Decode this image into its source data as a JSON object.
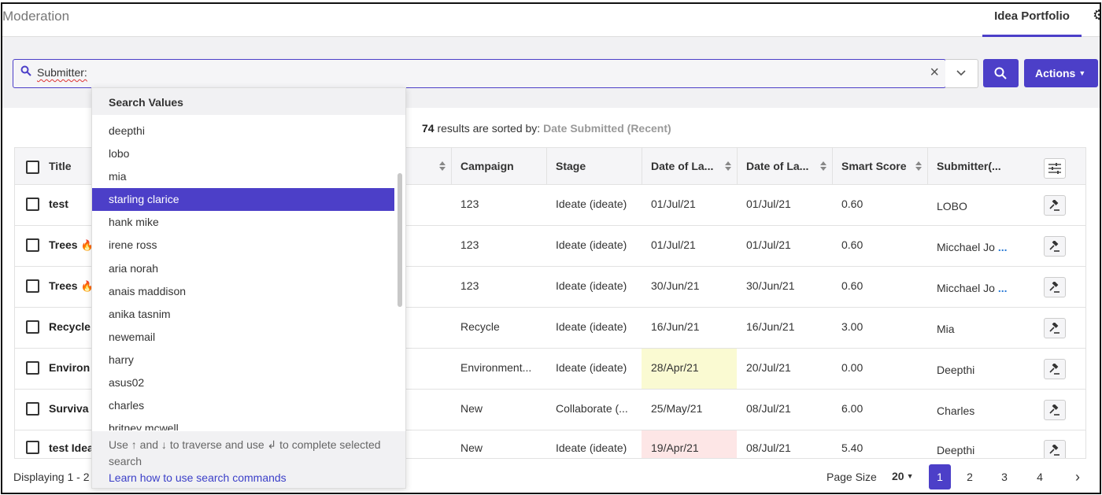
{
  "header": {
    "title": "Moderation",
    "tab": "Idea Portfolio",
    "settings_icon": "gear-icon"
  },
  "search": {
    "value": "Submitter:",
    "clear_icon": "close-icon",
    "toggle_icon": "chevron-down-icon",
    "search_icon": "search-icon",
    "actions_label": "Actions"
  },
  "results": {
    "count": "74",
    "text": "results are sorted by:",
    "sort": "Date Submitted (Recent)"
  },
  "columns": [
    "Title",
    "Campaign",
    "Stage",
    "Date of La...",
    "Date of La...",
    "Smart Score",
    "Submitter(..."
  ],
  "rows": [
    {
      "title": "test",
      "campaign": "123",
      "stage": "Ideate (ideate)",
      "d1": "01/Jul/21",
      "d2": "01/Jul/21",
      "score": "0.60",
      "submitter": "LOBO"
    },
    {
      "title": "Trees",
      "flame": "🔥",
      "campaign": "123",
      "stage": "Ideate (ideate)",
      "d1": "01/Jul/21",
      "d2": "01/Jul/21",
      "score": "0.60",
      "submitter": "Micchael Jo",
      "more": "..."
    },
    {
      "title": "Trees",
      "flame": "🔥",
      "campaign": "123",
      "stage": "Ideate (ideate)",
      "d1": "30/Jun/21",
      "d2": "30/Jun/21",
      "score": "0.60",
      "submitter": "Micchael Jo",
      "more": "..."
    },
    {
      "title": "Recycle",
      "campaign": "Recycle",
      "stage": "Ideate (ideate)",
      "d1": "16/Jun/21",
      "d2": "16/Jun/21",
      "score": "3.00",
      "submitter": "Mia"
    },
    {
      "title": "Environ",
      "campaign": "Environment...",
      "stage": "Ideate (ideate)",
      "d1": "28/Apr/21",
      "d2": "20/Jul/21",
      "score": "0.00",
      "submitter": "Deepthi",
      "d1_highlight": "#fafad2"
    },
    {
      "title": "Surviva",
      "campaign": "New",
      "stage": "Collaborate (...",
      "d1": "25/May/21",
      "d2": "08/Jul/21",
      "score": "6.00",
      "submitter": "Charles"
    },
    {
      "title": "test Idea",
      "campaign": "New",
      "stage": "Ideate (ideate)",
      "d1": "19/Apr/21",
      "d2": "08/Jul/21",
      "score": "5.40",
      "submitter": "Deepthi",
      "d1_highlight": "#fde6e6"
    }
  ],
  "dropdown": {
    "header": "Search Values",
    "items": [
      "deepthi",
      "lobo",
      "mia",
      "starling clarice",
      "hank mike",
      "irene ross",
      "aria norah",
      "anais maddison",
      "anika tasnim",
      "newemail",
      "harry",
      "asus02",
      "charles",
      "britney mcwell"
    ],
    "selected": "starling clarice",
    "hint": "Use ↑ and ↓ to traverse and use ↲ to complete selected search",
    "link": "Learn how to use search commands"
  },
  "footer": {
    "display": "Displaying 1 - 2",
    "page_size_label": "Page Size",
    "page_size": "20",
    "pages": [
      "1",
      "2",
      "3",
      "4"
    ],
    "next": "›",
    "active_page": "1"
  },
  "colors": {
    "accent": "#4c3fc8"
  }
}
